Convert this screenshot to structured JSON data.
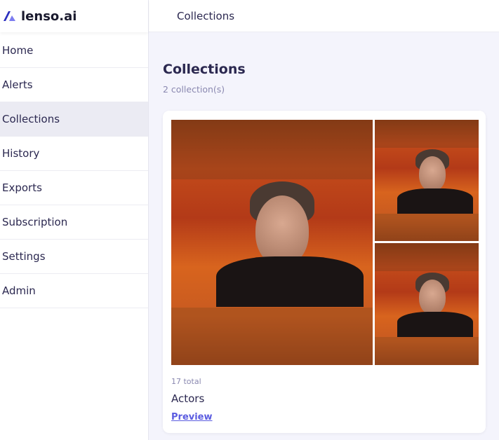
{
  "brand": {
    "name": "lenso.ai",
    "accent": "#5b5ce0"
  },
  "sidebar": {
    "items": [
      {
        "label": "Home"
      },
      {
        "label": "Alerts"
      },
      {
        "label": "Collections",
        "active": true
      },
      {
        "label": "History"
      },
      {
        "label": "Exports"
      },
      {
        "label": "Subscription"
      },
      {
        "label": "Settings"
      },
      {
        "label": "Admin"
      }
    ]
  },
  "topbar": {
    "title": "Collections"
  },
  "main": {
    "title": "Collections",
    "count": "2 collection(s)",
    "collections": [
      {
        "total": "17 total",
        "name": "Actors",
        "preview_label": "Preview"
      }
    ]
  }
}
